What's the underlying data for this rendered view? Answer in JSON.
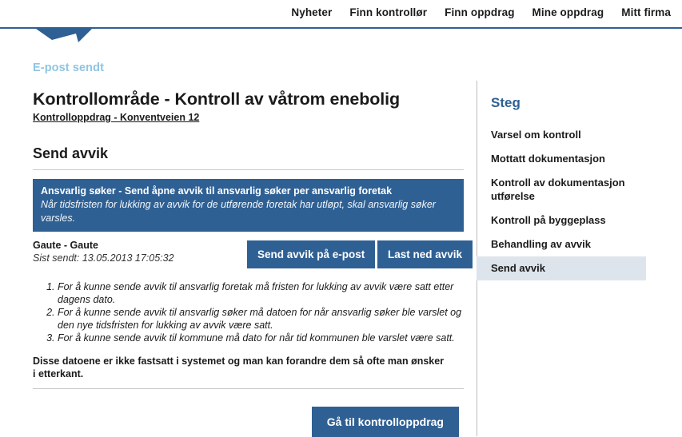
{
  "topnav": {
    "items": [
      {
        "label": "Nyheter"
      },
      {
        "label": "Finn kontrollør"
      },
      {
        "label": "Finn oppdrag"
      },
      {
        "label": "Mine oppdrag"
      },
      {
        "label": "Mitt firma"
      }
    ],
    "logo_icon": "blue-flag-triangle"
  },
  "flash": {
    "message": "E-post sendt",
    "color": "#8ec5e2"
  },
  "main": {
    "page_title": "Kontrollområde - Kontroll av våtrom enebolig",
    "breadcrumb_link": "Kontrolloppdrag - Konventveien 12",
    "section_title": "Send avvik",
    "banner": {
      "title": "Ansvarlig søker - Send åpne avvik til ansvarlig søker per ansvarlig foretak",
      "subtitle": "Når tidsfristen for lukking av avvik for de utførende foretak har utløpt, skal ansvarlig søker varsles.",
      "background_color": "#2f6094"
    },
    "sender": {
      "name": "Gaute - Gaute",
      "timestamp": "Sist sendt: 13.05.2013 17:05:32"
    },
    "buttons": {
      "send_email": "Send avvik på e-post",
      "download": "Last ned avvik",
      "goto_assignment": "Gå til kontrolloppdrag",
      "color": "#2f6094"
    },
    "rules": [
      "For å kunne sende avvik til ansvarlig foretak må fristen for lukking av avvik være satt etter dagens dato.",
      "For å kunne sende avvik til ansvarlig søker må datoen for når ansvarlig søker ble varslet og den nye tidsfristen for lukking av avvik være satt.",
      "For å kunne sende avvik til kommune må dato for når tid kommunen ble varslet være satt."
    ],
    "closing_note": "Disse datoene er ikke fastsatt i systemet og man kan forandre dem så ofte man ønsker i etterkant."
  },
  "sidebar": {
    "heading": "Steg",
    "active_index": 5,
    "highlight_color": "#dde4ec",
    "items": [
      {
        "label": "Varsel om kontroll"
      },
      {
        "label": "Mottatt dokumentasjon"
      },
      {
        "label": "Kontroll av dokumentasjon utførelse"
      },
      {
        "label": "Kontroll på byggeplass"
      },
      {
        "label": "Behandling av avvik"
      },
      {
        "label": "Send avvik"
      }
    ]
  }
}
